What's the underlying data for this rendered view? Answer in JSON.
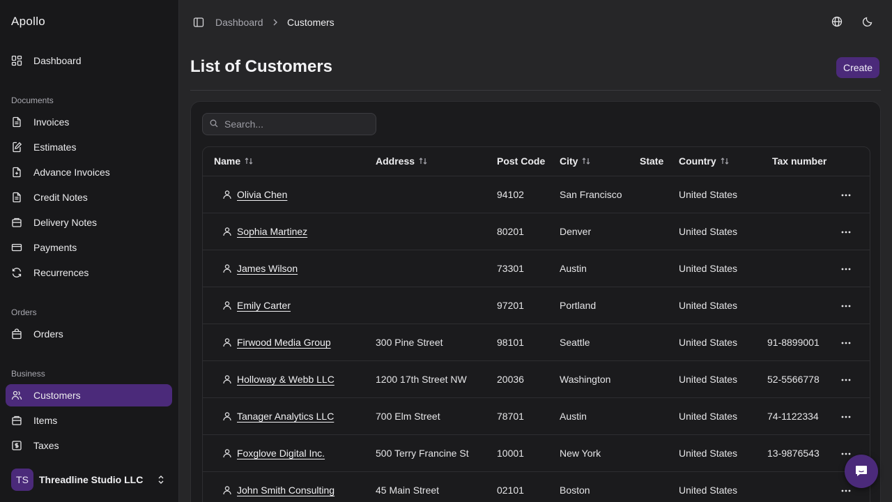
{
  "app": {
    "brand": "Apollo"
  },
  "sidebar": {
    "dashboard": "Dashboard",
    "sections": {
      "documents": "Documents",
      "orders": "Orders",
      "business": "Business"
    },
    "items": [
      {
        "label": "Invoices",
        "icon": "file-text-icon"
      },
      {
        "label": "Estimates",
        "icon": "file-edit-icon"
      },
      {
        "label": "Advance Invoices",
        "icon": "file-plus-icon"
      },
      {
        "label": "Credit Notes",
        "icon": "file-minus-icon"
      },
      {
        "label": "Delivery Notes",
        "icon": "package-icon"
      },
      {
        "label": "Payments",
        "icon": "credit-card-icon"
      },
      {
        "label": "Recurrences",
        "icon": "refresh-icon"
      },
      {
        "label": "Orders",
        "icon": "shopping-bag-icon"
      },
      {
        "label": "Customers",
        "icon": "users-icon",
        "active": true
      },
      {
        "label": "Items",
        "icon": "box-icon"
      },
      {
        "label": "Taxes",
        "icon": "receipt-icon"
      }
    ],
    "user": {
      "initials": "TS",
      "name": "Threadline Studio LLC"
    }
  },
  "header": {
    "breadcrumb": [
      "Dashboard",
      "Customers"
    ]
  },
  "main": {
    "title": "List of Customers",
    "create_label": "Create",
    "search_placeholder": "Search...",
    "columns": {
      "name": "Name",
      "address": "Address",
      "post_code": "Post Code",
      "city": "City",
      "state": "State",
      "country": "Country",
      "tax_number": "Tax number"
    },
    "rows": [
      {
        "name": "Olivia Chen",
        "address": "",
        "post_code": "94102",
        "city": "San Francisco",
        "state": "",
        "country": "United States",
        "tax": ""
      },
      {
        "name": "Sophia Martinez",
        "address": "",
        "post_code": "80201",
        "city": "Denver",
        "state": "",
        "country": "United States",
        "tax": ""
      },
      {
        "name": "James Wilson",
        "address": "",
        "post_code": "73301",
        "city": "Austin",
        "state": "",
        "country": "United States",
        "tax": ""
      },
      {
        "name": "Emily Carter",
        "address": "",
        "post_code": "97201",
        "city": "Portland",
        "state": "",
        "country": "United States",
        "tax": ""
      },
      {
        "name": "Firwood Media Group",
        "address": "300 Pine Street",
        "post_code": "98101",
        "city": "Seattle",
        "state": "",
        "country": "United States",
        "tax": "91-8899001"
      },
      {
        "name": "Holloway & Webb LLC",
        "address": "1200 17th Street NW",
        "post_code": "20036",
        "city": "Washington",
        "state": "",
        "country": "United States",
        "tax": "52-5566778"
      },
      {
        "name": "Tanager Analytics LLC",
        "address": "700 Elm Street",
        "post_code": "78701",
        "city": "Austin",
        "state": "",
        "country": "United States",
        "tax": "74-1122334"
      },
      {
        "name": "Foxglove Digital Inc.",
        "address": "500 Terry Francine St",
        "post_code": "10001",
        "city": "New York",
        "state": "",
        "country": "United States",
        "tax": "13-9876543"
      },
      {
        "name": "John Smith Consulting",
        "address": "45 Main Street",
        "post_code": "02101",
        "city": "Boston",
        "state": "",
        "country": "United States",
        "tax": ""
      }
    ]
  },
  "colors": {
    "accent": "#4b2a7a",
    "sidebar_bg": "#18181a",
    "page_bg": "#262628"
  }
}
